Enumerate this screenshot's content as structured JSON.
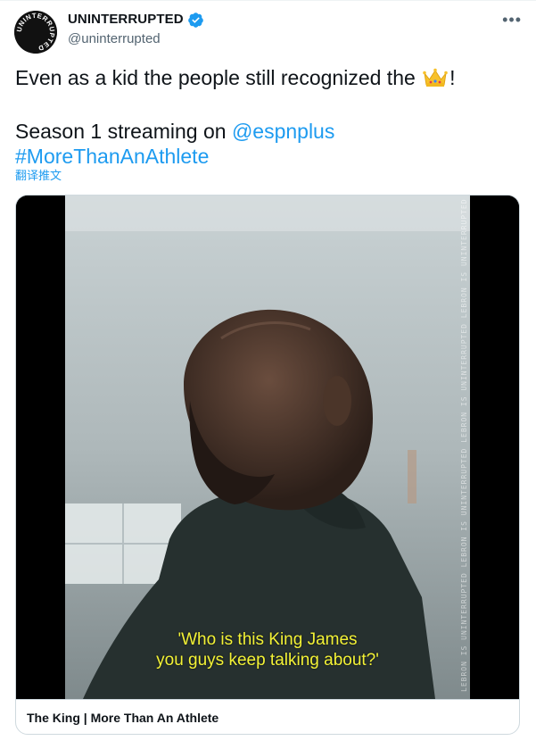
{
  "author": {
    "display_name": "UNINTERRUPTED",
    "handle": "@uninterrupted",
    "avatar_text": "UNINTERRUPTED",
    "verified": true
  },
  "tweet": {
    "text_before_emoji": "Even as a kid the people still recognized the ",
    "emoji": "crown",
    "text_after_emoji": "!",
    "line2_prefix": "Season 1 streaming on ",
    "mention": "@espnplus",
    "hashtag": "#MoreThanAnAthlete",
    "translate_label": "翻译推文"
  },
  "video": {
    "subtitle_line1": "'Who is this King James",
    "subtitle_line2": "you guys keep talking about?'",
    "side_caption": "LEBRON IS UNINTERRUPTED LEBRON IS UNINTERRUPTED LEBRON IS UNINTERRUPTED LEBRON IS UNINTERRUPTED LE"
  },
  "card": {
    "title": "The King | More Than An Athlete"
  },
  "colors": {
    "link": "#1d9bf0",
    "verified": "#1d9bf0",
    "subtitle": "#f3f236"
  }
}
